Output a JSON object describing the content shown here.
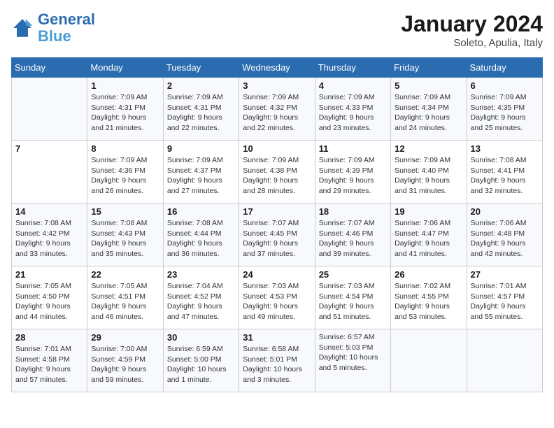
{
  "logo": {
    "line1": "General",
    "line2": "Blue"
  },
  "title": "January 2024",
  "subtitle": "Soleto, Apulia, Italy",
  "days_of_week": [
    "Sunday",
    "Monday",
    "Tuesday",
    "Wednesday",
    "Thursday",
    "Friday",
    "Saturday"
  ],
  "weeks": [
    [
      {
        "day": "",
        "info": ""
      },
      {
        "day": "1",
        "info": "Sunrise: 7:09 AM\nSunset: 4:31 PM\nDaylight: 9 hours\nand 21 minutes."
      },
      {
        "day": "2",
        "info": "Sunrise: 7:09 AM\nSunset: 4:31 PM\nDaylight: 9 hours\nand 22 minutes."
      },
      {
        "day": "3",
        "info": "Sunrise: 7:09 AM\nSunset: 4:32 PM\nDaylight: 9 hours\nand 22 minutes."
      },
      {
        "day": "4",
        "info": "Sunrise: 7:09 AM\nSunset: 4:33 PM\nDaylight: 9 hours\nand 23 minutes."
      },
      {
        "day": "5",
        "info": "Sunrise: 7:09 AM\nSunset: 4:34 PM\nDaylight: 9 hours\nand 24 minutes."
      },
      {
        "day": "6",
        "info": "Sunrise: 7:09 AM\nSunset: 4:35 PM\nDaylight: 9 hours\nand 25 minutes."
      }
    ],
    [
      {
        "day": "7",
        "info": ""
      },
      {
        "day": "8",
        "info": "Sunrise: 7:09 AM\nSunset: 4:36 PM\nDaylight: 9 hours\nand 26 minutes."
      },
      {
        "day": "9",
        "info": "Sunrise: 7:09 AM\nSunset: 4:37 PM\nDaylight: 9 hours\nand 27 minutes."
      },
      {
        "day": "10",
        "info": "Sunrise: 7:09 AM\nSunset: 4:38 PM\nDaylight: 9 hours\nand 28 minutes."
      },
      {
        "day": "11",
        "info": "Sunrise: 7:09 AM\nSunset: 4:39 PM\nDaylight: 9 hours\nand 29 minutes."
      },
      {
        "day": "12",
        "info": "Sunrise: 7:09 AM\nSunset: 4:40 PM\nDaylight: 9 hours\nand 31 minutes."
      },
      {
        "day": "13",
        "info": "Sunrise: 7:08 AM\nSunset: 4:41 PM\nDaylight: 9 hours\nand 32 minutes."
      }
    ],
    [
      {
        "day": "14",
        "info": "Sunrise: 7:08 AM\nSunset: 4:42 PM\nDaylight: 9 hours\nand 33 minutes."
      },
      {
        "day": "15",
        "info": "Sunrise: 7:08 AM\nSunset: 4:43 PM\nDaylight: 9 hours\nand 35 minutes."
      },
      {
        "day": "16",
        "info": "Sunrise: 7:08 AM\nSunset: 4:44 PM\nDaylight: 9 hours\nand 36 minutes."
      },
      {
        "day": "17",
        "info": "Sunrise: 7:07 AM\nSunset: 4:45 PM\nDaylight: 9 hours\nand 37 minutes."
      },
      {
        "day": "18",
        "info": "Sunrise: 7:07 AM\nSunset: 4:46 PM\nDaylight: 9 hours\nand 39 minutes."
      },
      {
        "day": "19",
        "info": "Sunrise: 7:06 AM\nSunset: 4:47 PM\nDaylight: 9 hours\nand 41 minutes."
      },
      {
        "day": "20",
        "info": "Sunrise: 7:06 AM\nSunset: 4:48 PM\nDaylight: 9 hours\nand 42 minutes."
      }
    ],
    [
      {
        "day": "21",
        "info": "Sunrise: 7:05 AM\nSunset: 4:50 PM\nDaylight: 9 hours\nand 44 minutes."
      },
      {
        "day": "22",
        "info": "Sunrise: 7:05 AM\nSunset: 4:51 PM\nDaylight: 9 hours\nand 46 minutes."
      },
      {
        "day": "23",
        "info": "Sunrise: 7:04 AM\nSunset: 4:52 PM\nDaylight: 9 hours\nand 47 minutes."
      },
      {
        "day": "24",
        "info": "Sunrise: 7:03 AM\nSunset: 4:53 PM\nDaylight: 9 hours\nand 49 minutes."
      },
      {
        "day": "25",
        "info": "Sunrise: 7:03 AM\nSunset: 4:54 PM\nDaylight: 9 hours\nand 51 minutes."
      },
      {
        "day": "26",
        "info": "Sunrise: 7:02 AM\nSunset: 4:55 PM\nDaylight: 9 hours\nand 53 minutes."
      },
      {
        "day": "27",
        "info": "Sunrise: 7:01 AM\nSunset: 4:57 PM\nDaylight: 9 hours\nand 55 minutes."
      }
    ],
    [
      {
        "day": "28",
        "info": "Sunrise: 7:01 AM\nSunset: 4:58 PM\nDaylight: 9 hours\nand 57 minutes."
      },
      {
        "day": "29",
        "info": "Sunrise: 7:00 AM\nSunset: 4:59 PM\nDaylight: 9 hours\nand 59 minutes."
      },
      {
        "day": "30",
        "info": "Sunrise: 6:59 AM\nSunset: 5:00 PM\nDaylight: 10 hours\nand 1 minute."
      },
      {
        "day": "31",
        "info": "Sunrise: 6:58 AM\nSunset: 5:01 PM\nDaylight: 10 hours\nand 3 minutes."
      },
      {
        "day": "",
        "info": "Sunrise: 6:57 AM\nSunset: 5:03 PM\nDaylight: 10 hours\nand 5 minutes."
      },
      {
        "day": "",
        "info": ""
      },
      {
        "day": "",
        "info": ""
      }
    ]
  ]
}
